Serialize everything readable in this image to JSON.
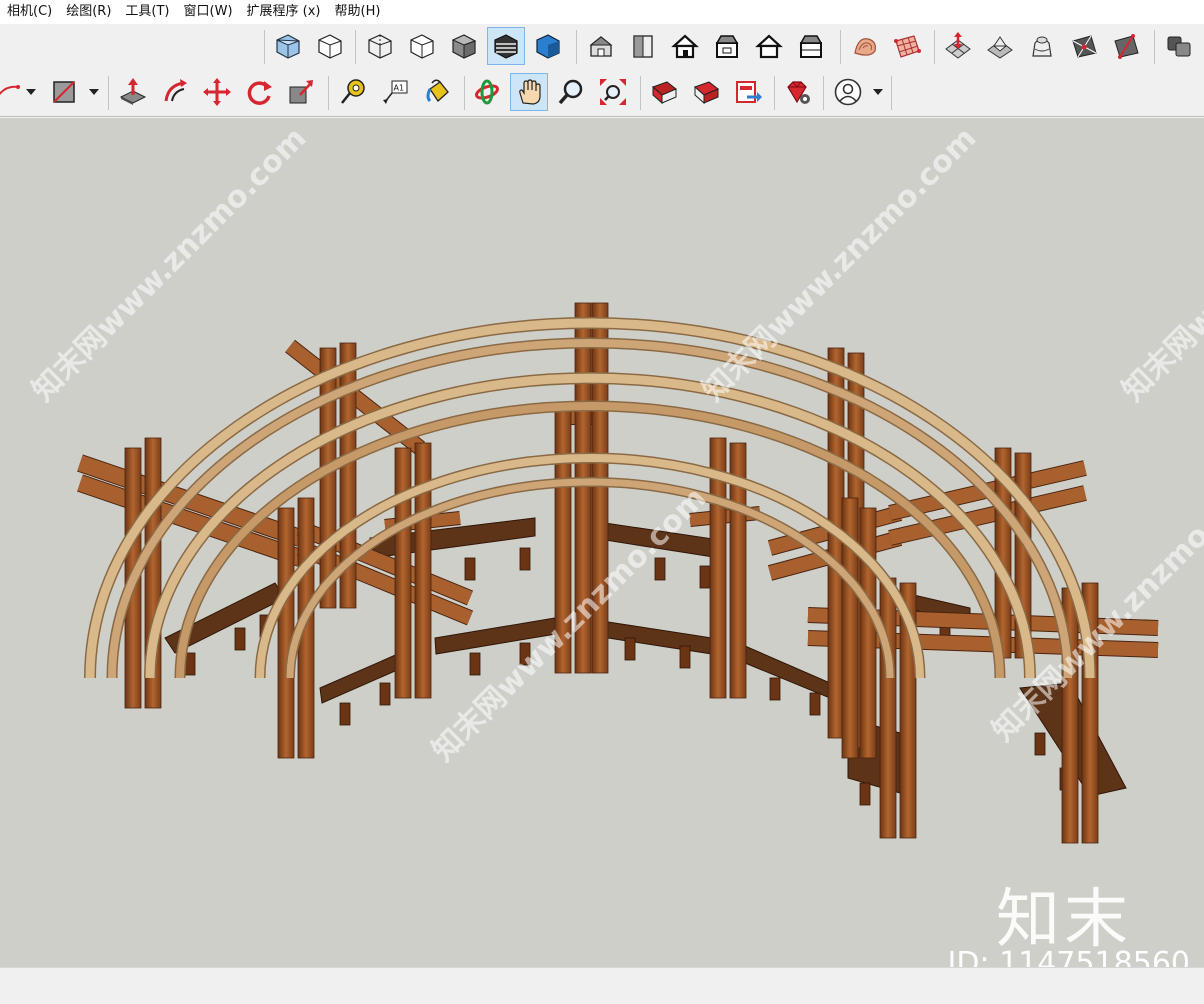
{
  "menu": [
    "相机(C)",
    "绘图(R)",
    "工具(T)",
    "窗口(W)",
    "扩展程序 (x)",
    "帮助(H)"
  ],
  "watermark": {
    "text": "知末网www.znzmo.com",
    "brand": "知末",
    "id": "ID: 1147518560"
  },
  "toolbar_top": {
    "icons": [
      "xray-style-icon",
      "back-edges-style-icon",
      "wireframe-style-icon",
      "hidden-line-style-icon",
      "shaded-style-icon",
      "shaded-textures-style-icon",
      "monochrome-style-icon",
      "iso-view-icon",
      "top-view-icon",
      "front-view-icon",
      "right-view-icon",
      "back-view-icon",
      "left-view-icon",
      "sandbox-contours-icon",
      "sandbox-grid-icon",
      "sandbox-smoove-icon",
      "sandbox-stamp-icon",
      "sandbox-drape-icon",
      "sandbox-add-detail-icon",
      "sandbox-flip-edge-icon",
      "components-icon"
    ],
    "active": "shaded-textures-style-icon"
  },
  "toolbar_bottom": {
    "icons": [
      "arc-tool-icon",
      "rectangle-tool-icon",
      "push-pull-icon",
      "follow-me-icon",
      "move-tool-icon",
      "rotate-tool-icon",
      "scale-tool-icon",
      "tape-measure-icon",
      "text-tool-icon",
      "paint-bucket-icon",
      "orbit-tool-icon",
      "pan-tool-icon",
      "zoom-tool-icon",
      "zoom-extents-icon",
      "warehouse-icon",
      "share-model-icon",
      "send-to-layout-icon",
      "extension-warehouse-icon",
      "account-icon"
    ],
    "active": "pan-tool-icon"
  },
  "colors": {
    "viewport": "#cfcfca",
    "wood_dark": "#8a4a22",
    "wood_mid": "#a8602e",
    "wood_light": "#d9b98a",
    "accent_red": "#d6262f",
    "accent_blue": "#2b7fd0"
  }
}
